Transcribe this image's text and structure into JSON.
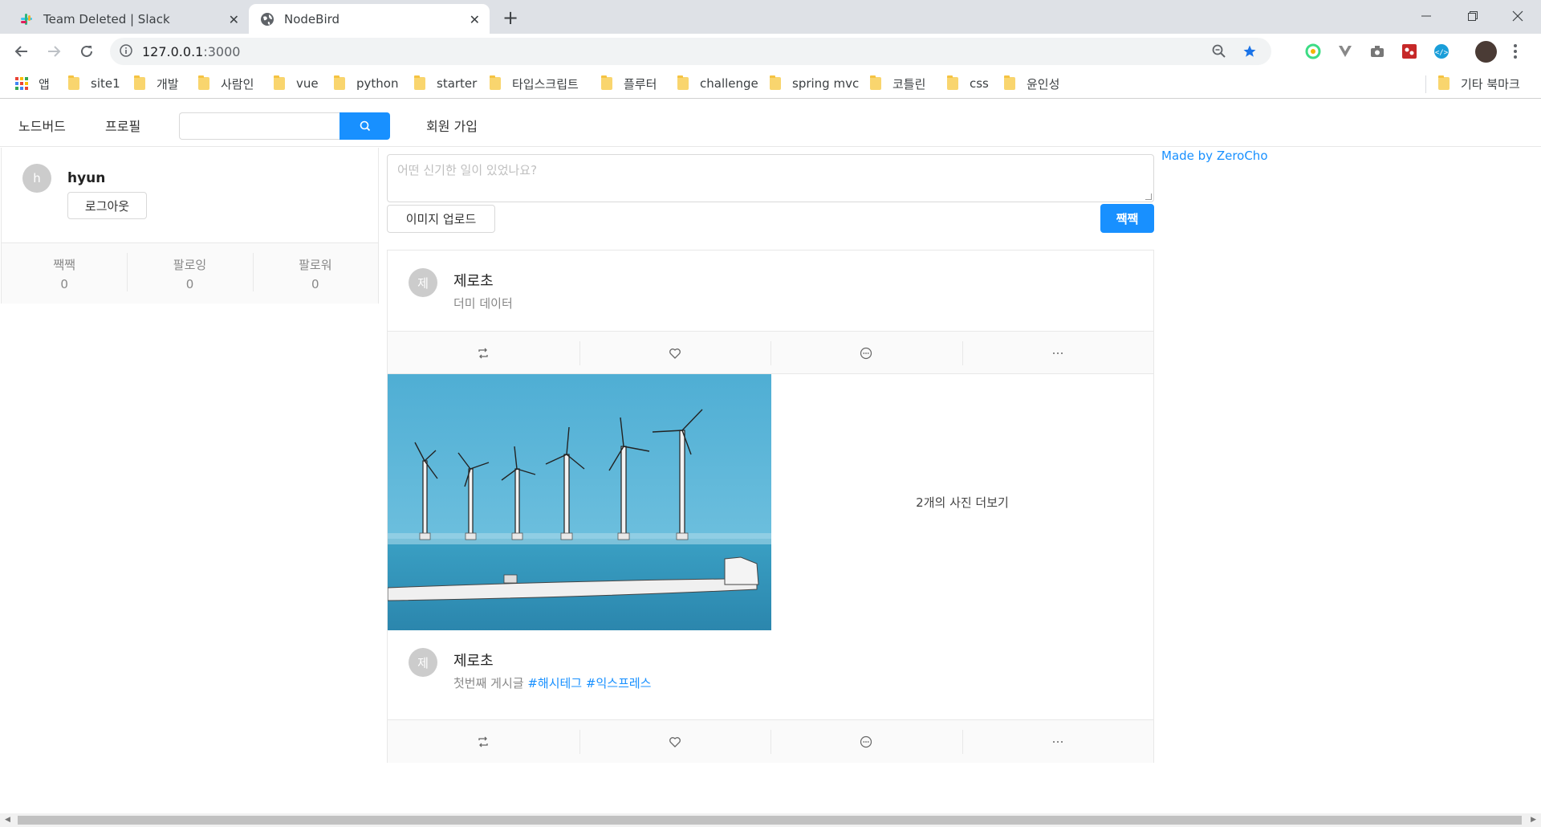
{
  "browser": {
    "tabs": [
      {
        "title": "Team Deleted | Slack",
        "favicon": "slack-icon"
      },
      {
        "title": "NodeBird",
        "favicon": "globe-icon"
      }
    ],
    "address": {
      "host": "127.0.0.1",
      "port": ":3000"
    },
    "bookmarks": [
      "site1",
      "개발",
      "사람인",
      "vue",
      "python",
      "starter",
      "타입스크립트",
      "플루터",
      "challenge",
      "spring mvc",
      "코틀린",
      "css",
      "윤인성"
    ],
    "apps_label": "앱",
    "other_bookmarks": "기타 북마크"
  },
  "menu": {
    "home": "노드버드",
    "profile": "프로필",
    "signup": "회원 가입"
  },
  "user": {
    "avatar_letter": "h",
    "name": "hyun",
    "logout": "로그아웃",
    "stats": [
      {
        "label": "짹짹",
        "value": "0"
      },
      {
        "label": "팔로잉",
        "value": "0"
      },
      {
        "label": "팔로워",
        "value": "0"
      }
    ]
  },
  "post_form": {
    "placeholder": "어떤 신기한 일이 있었나요?",
    "upload_label": "이미지 업로드",
    "submit_label": "짹짹"
  },
  "posts": [
    {
      "avatar_letter": "제",
      "author": "제로초",
      "content": "더미 데이터"
    },
    {
      "avatar_letter": "제",
      "author": "제로초",
      "content_prefix": "첫번째 게시글 ",
      "tags": [
        "#해시테그",
        "#익스프레스"
      ],
      "more_photos": "2개의 사진 더보기"
    }
  ],
  "footer_link": "Made by ZeroCho",
  "colors": {
    "primary": "#1890ff",
    "border": "#e8e8e8"
  }
}
